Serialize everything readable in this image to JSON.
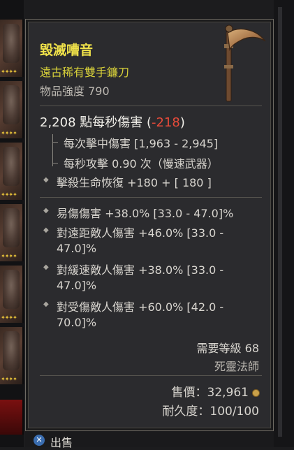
{
  "item": {
    "name": "毀滅嘈音",
    "type": "遠古稀有雙手鐮刀",
    "power": "物品強度 790",
    "dps_value": "2,208 點每秒傷害",
    "dps_delta": "-218",
    "dps_open": " (",
    "dps_close": ")"
  },
  "base_stats": [
    {
      "label": "每次擊中傷害 [1,963 - 2,945]"
    },
    {
      "label": "每秒攻擊 0.90 次（慢速武器）"
    },
    {
      "label": "擊殺生命恢復 +180 + [ 180 ]"
    }
  ],
  "affixes": [
    {
      "line1": "易傷傷害 +38.0% [33.0 - 47.0]%",
      "line2": ""
    },
    {
      "line1": "對遠距敵人傷害 +46.0% [33.0 -",
      "line2": "47.0]%"
    },
    {
      "line1": "對緩速敵人傷害 +38.0% [33.0 -",
      "line2": "47.0]%"
    },
    {
      "line1": "對受傷敵人傷害 +60.0% [42.0 -",
      "line2": "70.0]%"
    }
  ],
  "requirements": {
    "level": "需要等級 68",
    "class": "死靈法師"
  },
  "sell_price": "售價：32,961",
  "durability": "耐久度：100/100",
  "action": {
    "button_glyph": "✕",
    "label": "出售"
  },
  "inventory": {
    "stars": "✦✦✦✦"
  },
  "colors": {
    "legendary_name": "#f0e24a",
    "rarity_type": "#d7d03a",
    "negative_delta": "#e84b3a"
  }
}
